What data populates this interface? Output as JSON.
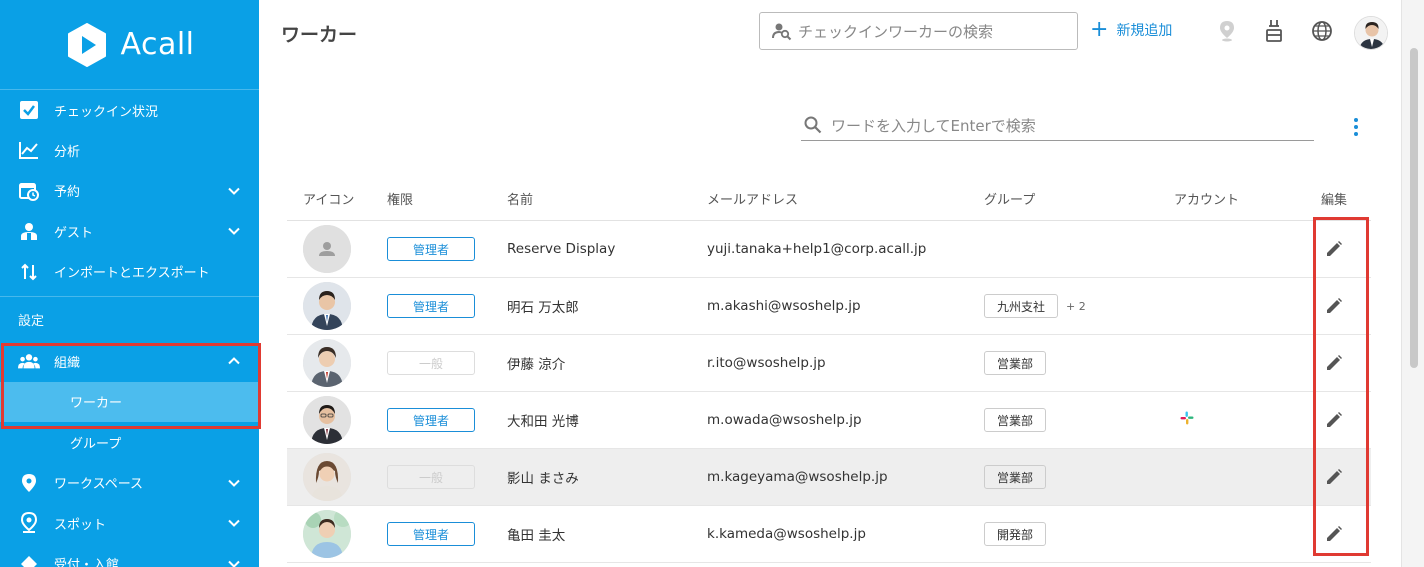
{
  "app": {
    "logo_text": "Acall"
  },
  "sidebar": {
    "items": [
      {
        "label": "チェックイン状況",
        "icon": "checkbox-icon"
      },
      {
        "label": "分析",
        "icon": "chart-line-icon"
      },
      {
        "label": "予約",
        "icon": "calendar-clock-icon",
        "expandable": true
      },
      {
        "label": "ゲスト",
        "icon": "guest-icon",
        "expandable": true
      },
      {
        "label": "インポートとエクスポート",
        "icon": "import-export-icon"
      }
    ],
    "section_label": "設定",
    "org": {
      "label": "組織",
      "icon": "people-icon",
      "expanded": true
    },
    "org_children": [
      {
        "label": "ワーカー",
        "active": true
      },
      {
        "label": "グループ"
      }
    ],
    "more_items": [
      {
        "label": "ワークスペース",
        "icon": "location-pin-icon"
      },
      {
        "label": "スポット",
        "icon": "spot-pin-icon"
      },
      {
        "label": "受付・入館",
        "icon": "reception-icon"
      }
    ]
  },
  "header": {
    "title": "ワーカー",
    "worker_search_placeholder": "チェックインワーカーの検索",
    "add_label": "新規追加"
  },
  "search": {
    "placeholder": "ワードを入力してEnterで検索"
  },
  "table": {
    "headers": {
      "icon": "アイコン",
      "role": "権限",
      "name": "名前",
      "email": "メールアドレス",
      "group": "グループ",
      "account": "アカウント",
      "edit": "編集"
    },
    "rows": [
      {
        "avatar": "default",
        "role": "管理者",
        "role_type": "admin",
        "name": "Reserve Display",
        "email": "yuji.tanaka+help1@corp.acall.jp",
        "group": "",
        "group_more": "",
        "account": ""
      },
      {
        "avatar": "photo",
        "role": "管理者",
        "role_type": "admin",
        "name": "明石 万太郎",
        "email": "m.akashi@wsoshelp.jp",
        "group": "九州支社",
        "group_more": "+ 2",
        "account": ""
      },
      {
        "avatar": "photo",
        "role": "一般",
        "role_type": "general",
        "name": "伊藤 涼介",
        "email": "r.ito@wsoshelp.jp",
        "group": "営業部",
        "group_more": "",
        "account": ""
      },
      {
        "avatar": "photo",
        "role": "管理者",
        "role_type": "admin",
        "name": "大和田 光博",
        "email": "m.owada@wsoshelp.jp",
        "group": "営業部",
        "group_more": "",
        "account": "slack"
      },
      {
        "avatar": "photo-female",
        "role": "一般",
        "role_type": "general",
        "name": "影山 まさみ",
        "email": "m.kageyama@wsoshelp.jp",
        "group": "営業部",
        "group_more": "",
        "account": ""
      },
      {
        "avatar": "photo",
        "role": "管理者",
        "role_type": "admin",
        "name": "亀田 圭太",
        "email": "k.kameda@wsoshelp.jp",
        "group": "開発部",
        "group_more": "",
        "account": ""
      }
    ]
  },
  "colors": {
    "sidebar": "#0aa0e6",
    "accent": "#1a8ed8",
    "highlight": "#e03a32"
  }
}
